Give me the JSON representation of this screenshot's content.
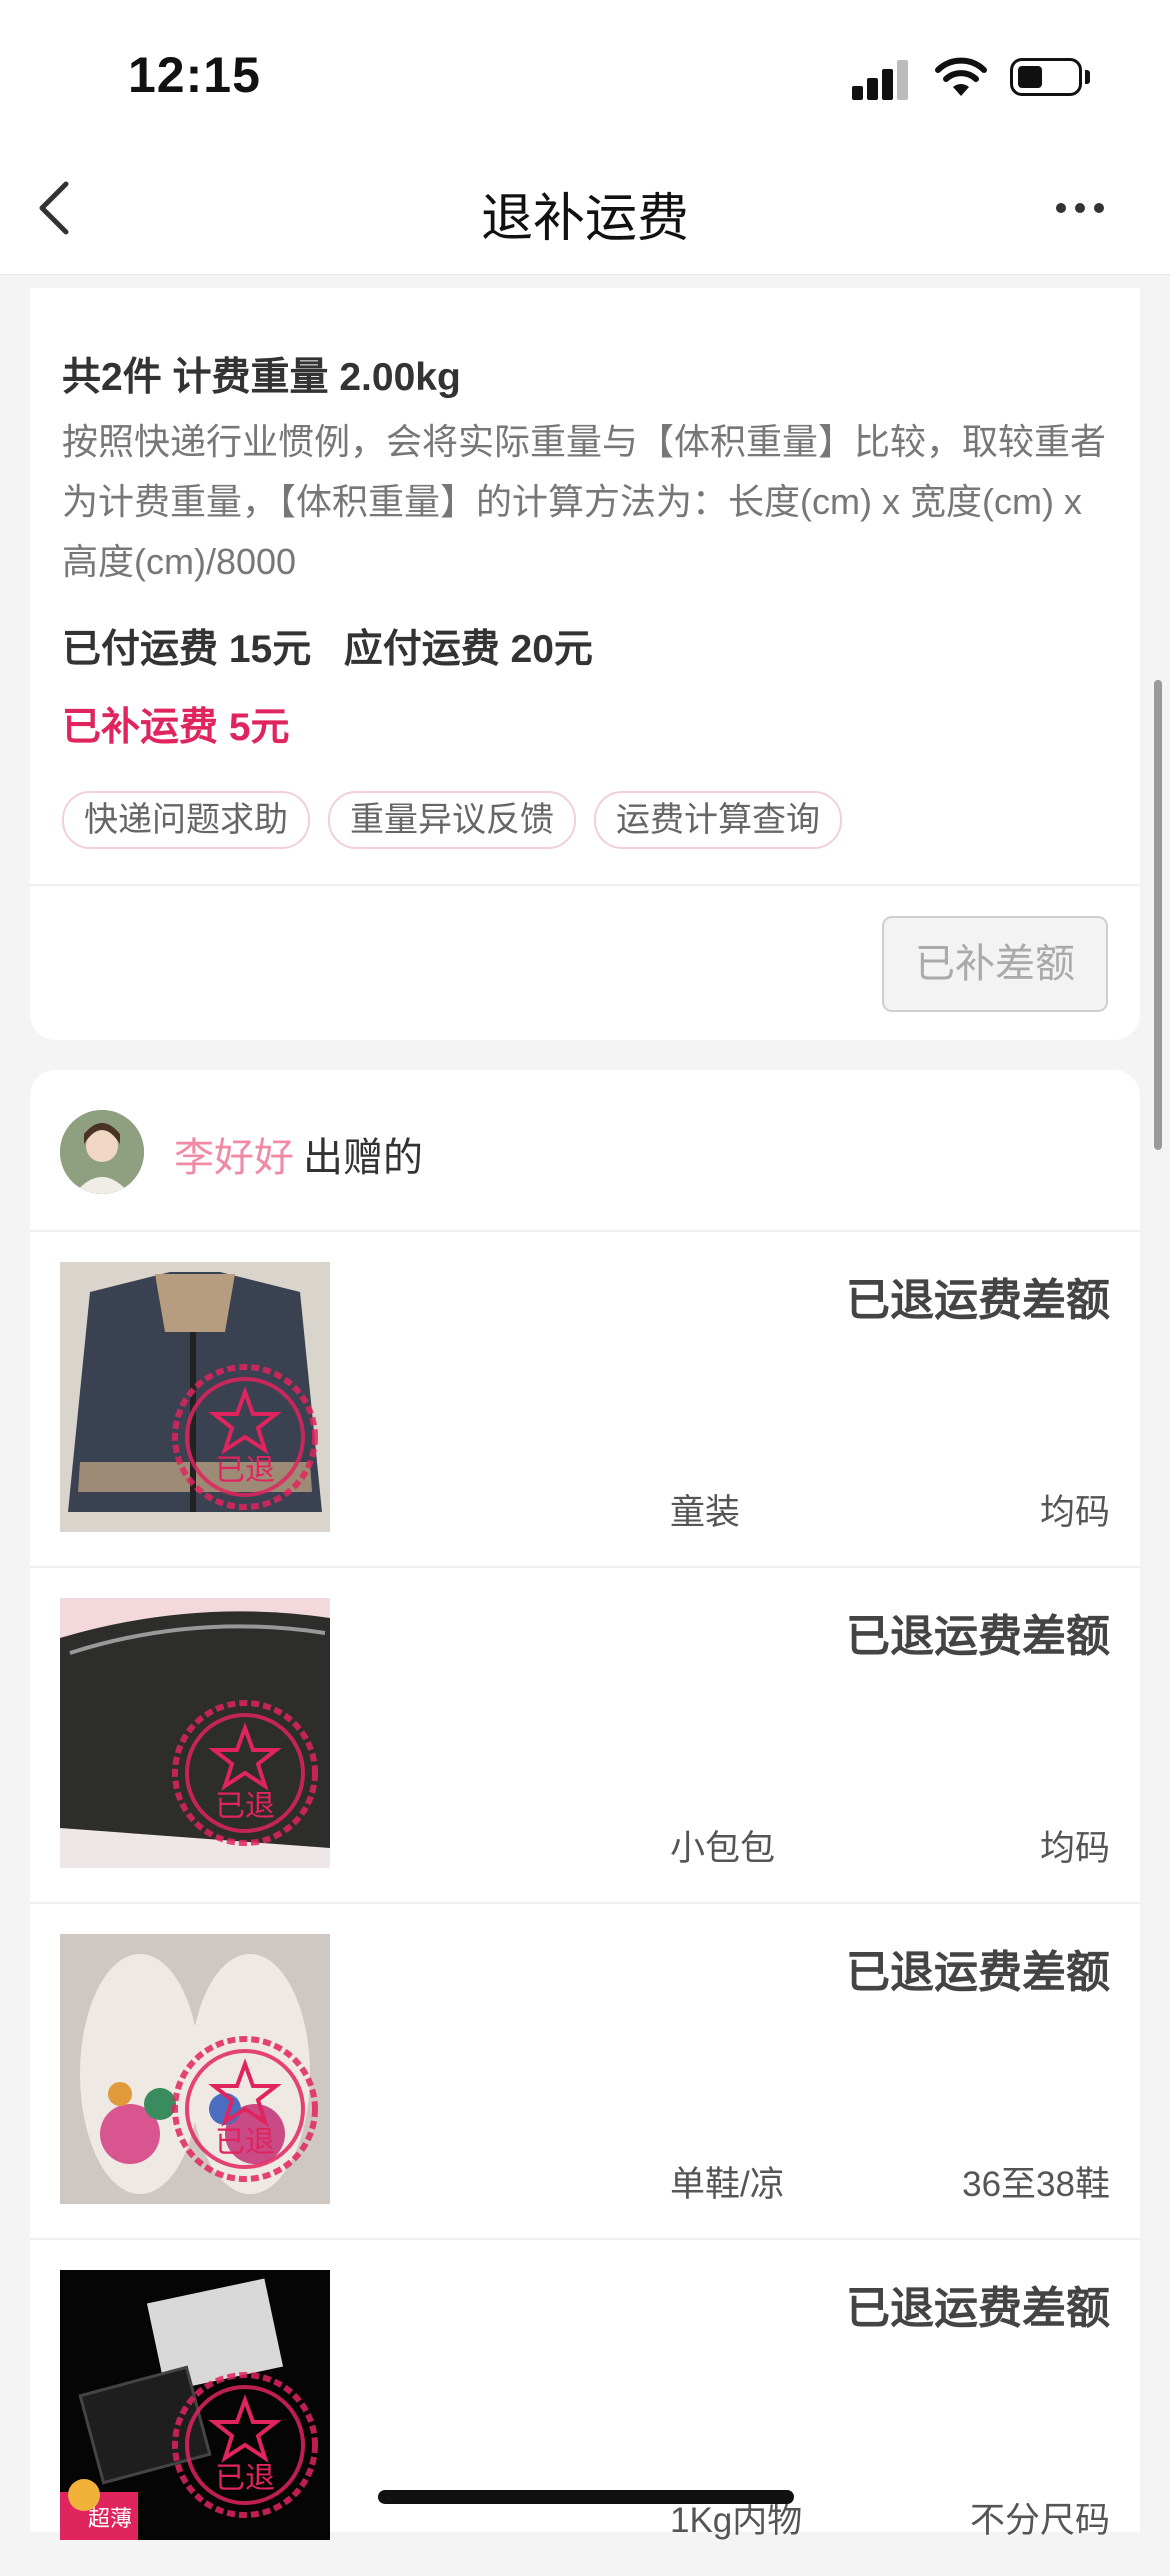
{
  "status_bar": {
    "time": "12:15"
  },
  "nav": {
    "title": "退补运费"
  },
  "shipping": {
    "summary": "共2件 计费重量 2.00kg",
    "description": "按照快递行业惯例，会将实际重量与【体积重量】比较，取较重者为计费重量，【体积重量】的计算方法为：长度(cm) x 宽度(cm) x 高度(cm)/8000",
    "fees": "已付运费 15元   应付运费 20元",
    "extra": "已补运费 5元",
    "tags": [
      "快递问题求助",
      "重量异议反馈",
      "运费计算查询"
    ],
    "button_label": "已补差额"
  },
  "donation": {
    "donor_name": "李好好",
    "donor_suffix": "出赠的",
    "items": [
      {
        "status": "已退运费差额",
        "category": "童装",
        "size": "均码",
        "stamp": "已退"
      },
      {
        "status": "已退运费差额",
        "category": "小包包",
        "size": "均码",
        "stamp": "已退"
      },
      {
        "status": "已退运费差额",
        "category": "单鞋/凉",
        "size": "36至38鞋",
        "stamp": "已退"
      },
      {
        "status": "已退运费差额",
        "category": "1Kg内物",
        "size": "不分尺码",
        "stamp": "已退",
        "badge": "超薄"
      }
    ]
  },
  "colors": {
    "accent": "#e0245e",
    "donor": "#f08aa5"
  }
}
